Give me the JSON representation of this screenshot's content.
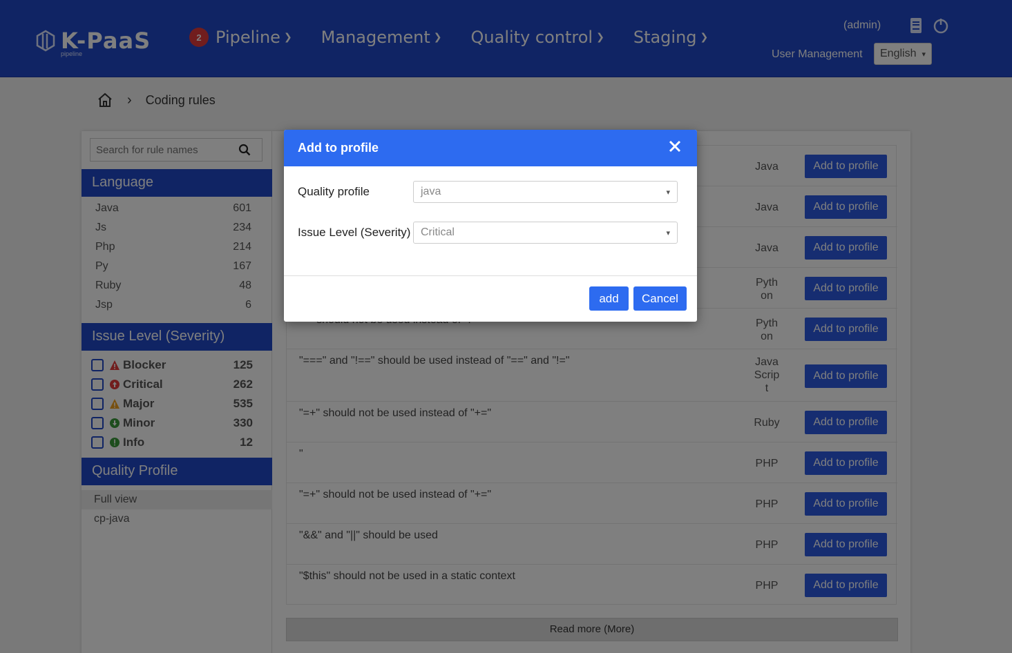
{
  "header": {
    "logo_text": "K-PaaS",
    "logo_sub": "pipeline",
    "badge_count": "2",
    "nav": [
      {
        "label": "Pipeline"
      },
      {
        "label": "Management"
      },
      {
        "label": "Quality control"
      },
      {
        "label": "Staging"
      }
    ],
    "admin": "(admin)",
    "user_management": "User Management",
    "language": "English"
  },
  "breadcrumb": {
    "current": "Coding rules"
  },
  "sidebar": {
    "search_placeholder": "Search for rule names",
    "language_title": "Language",
    "languages": [
      {
        "name": "Java",
        "count": "601"
      },
      {
        "name": "Js",
        "count": "234"
      },
      {
        "name": "Php",
        "count": "214"
      },
      {
        "name": "Py",
        "count": "167"
      },
      {
        "name": "Ruby",
        "count": "48"
      },
      {
        "name": "Jsp",
        "count": "6"
      }
    ],
    "severity_title": "Issue Level (Severity)",
    "severities": [
      {
        "name": "Blocker",
        "count": "125",
        "icon": "blocker-icon",
        "color": "#e23b3b"
      },
      {
        "name": "Critical",
        "count": "262",
        "icon": "critical-icon",
        "color": "#e23b3b"
      },
      {
        "name": "Major",
        "count": "535",
        "icon": "major-icon",
        "color": "#f0a020"
      },
      {
        "name": "Minor",
        "count": "330",
        "icon": "minor-icon",
        "color": "#3a9a3a"
      },
      {
        "name": "Info",
        "count": "12",
        "icon": "info-icon",
        "color": "#3a9a3a"
      }
    ],
    "profile_title": "Quality Profile",
    "profiles": [
      {
        "name": "Full view"
      },
      {
        "name": "cp-java"
      }
    ]
  },
  "rules": [
    {
      "title": "",
      "lang": "Java"
    },
    {
      "title": "",
      "lang": "Java"
    },
    {
      "title": "",
      "lang": "Java"
    },
    {
      "title": "",
      "lang": "Pyth on"
    },
    {
      "title": "\"=\" should not be used instead of \"!=\"",
      "lang": "Pyth on"
    },
    {
      "title": "\"===\" and \"!==\" should be used instead of \"==\" and \"!=\"",
      "lang": "Java Scrip t"
    },
    {
      "title": "\"=+\" should not be used instead of \"+=\"",
      "lang": "Ruby"
    },
    {
      "title": "\"",
      "lang": "PHP"
    },
    {
      "title": "\"=+\" should not be used instead of \"+=\"",
      "lang": "PHP"
    },
    {
      "title": "\"&&\" and \"||\" should be used",
      "lang": "PHP"
    },
    {
      "title": "\"$this\" should not be used in a static context",
      "lang": "PHP"
    }
  ],
  "add_to_profile_label": "Add to profile",
  "read_more": "Read more (More)",
  "modal": {
    "title": "Add to profile",
    "quality_profile_label": "Quality profile",
    "quality_profile_value": "java",
    "severity_label": "Issue Level (Severity)",
    "severity_value": "Critical",
    "add_label": "add",
    "cancel_label": "Cancel"
  }
}
